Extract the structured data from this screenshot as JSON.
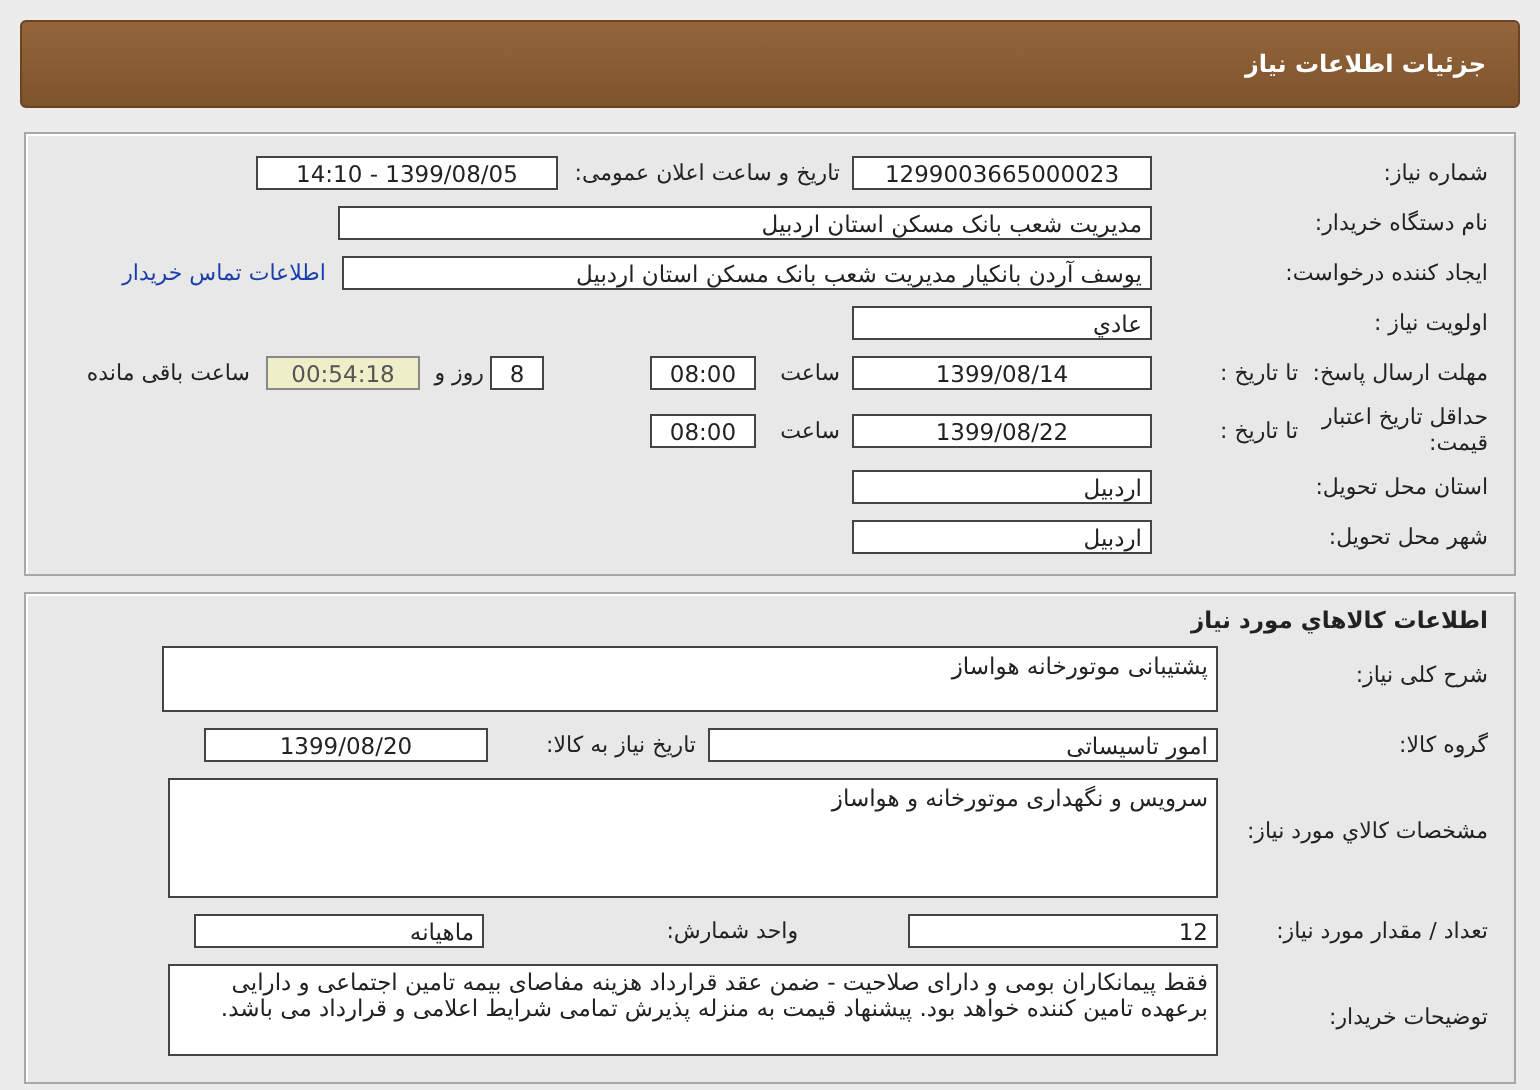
{
  "page_title": "جزئیات اطلاعات نیاز",
  "need_info": {
    "need_number": {
      "label": "شماره نیاز:",
      "value": "1299003665000023"
    },
    "announce": {
      "label": "تاریخ و ساعت اعلان عمومی:",
      "value": "1399/08/05 - 14:10"
    },
    "buyer": {
      "label": "نام دستگاه خریدار:",
      "value": "مدیریت شعب بانک مسکن استان اردبیل"
    },
    "requester": {
      "label": "ایجاد کننده درخواست:",
      "value": "یوسف  آردن بانکیار مدیریت شعب بانک مسکن استان اردبیل",
      "link": "اطلاعات تماس خریدار"
    },
    "priority": {
      "label": "اولویت نیاز :",
      "value": "عادي"
    },
    "deadline": {
      "label": "مهلت ارسال پاسخ:",
      "date_label": "تا تاریخ :",
      "date": "1399/08/14",
      "time_label": "ساعت",
      "time": "08:00",
      "days": "8",
      "days_label": "روز و",
      "remaining": "00:54:18",
      "remaining_label": "ساعت باقی مانده"
    },
    "validity": {
      "label": "حداقل تاریخ اعتبار قیمت:",
      "date_label": "تا تاریخ :",
      "date": "1399/08/22",
      "time_label": "ساعت",
      "time": "08:00"
    },
    "province": {
      "label": "استان محل تحویل:",
      "value": "اردبیل"
    },
    "city": {
      "label": "شهر محل تحویل:",
      "value": "اردبیل"
    }
  },
  "goods": {
    "title": "اطلاعات کالاهاي مورد نیاز",
    "description": {
      "label": "شرح کلی نیاز:",
      "value": "پشتیبانی موتورخانه هواساز"
    },
    "group": {
      "label": "گروه کالا:",
      "value": "امور تاسیساتی",
      "need_date_label": "تاریخ نیاز به کالا:",
      "need_date": "1399/08/20"
    },
    "specs": {
      "label": "مشخصات کالاي مورد نیاز:",
      "value": "سرویس و نگهداری موتورخانه و هواساز"
    },
    "quantity": {
      "label": "تعداد / مقدار مورد نیاز:",
      "value": "12",
      "unit_label": "واحد شمارش:",
      "unit": "ماهیانه"
    },
    "notes": {
      "label": "توضیحات خریدار:",
      "value": "فقط پیمانکاران بومی و دارای صلاحیت - ضمن عقد قرارداد هزینه مفاصای بیمه تامین اجتماعی و دارایی برعهده تامین کننده خواهد بود. پیشنهاد قیمت به منزله پذیرش تمامی شرایط اعلامی و قرارداد می باشد."
    }
  }
}
